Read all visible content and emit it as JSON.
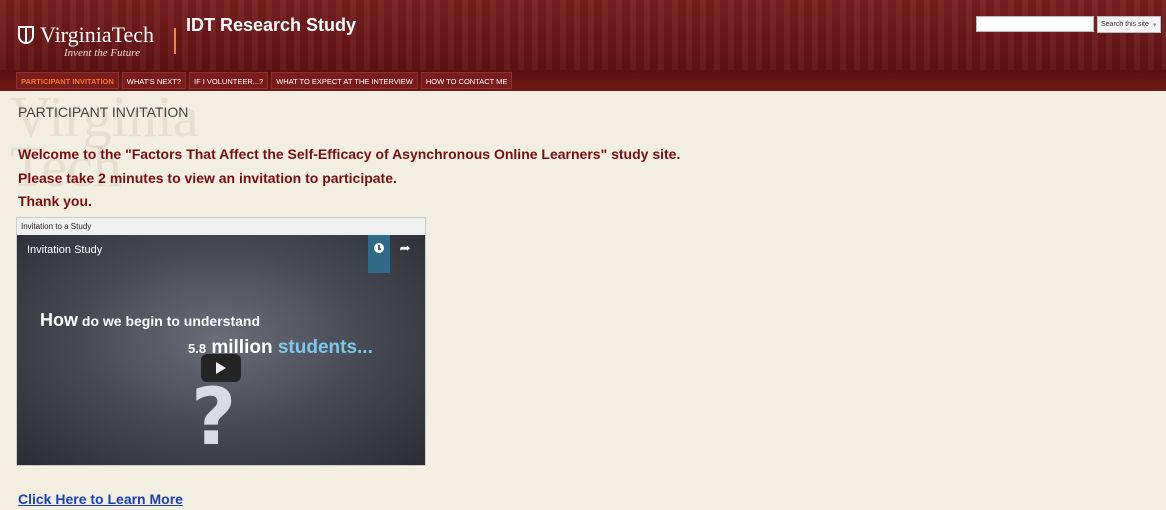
{
  "header": {
    "logo_text": "VirginiaTech",
    "logo_tagline": "Invent the Future",
    "site_title": "IDT Research Study",
    "search_placeholder": "",
    "search_button_label": "Search this site",
    "search_dropdown_glyph": "▾"
  },
  "nav": {
    "items": [
      {
        "label": "PARTICIPANT INVITATION"
      },
      {
        "label": "WHAT'S NEXT?"
      },
      {
        "label": "IF I VOLUNTEER...?"
      },
      {
        "label": "WHAT TO EXPECT AT THE INTERVIEW"
      },
      {
        "label": "HOW TO CONTACT ME"
      }
    ]
  },
  "main": {
    "watermark": "Virginia Tech",
    "page_heading": "PARTICIPANT INVITATION",
    "welcome_line1": "Welcome to the \"Factors That Affect the Self-Efficacy of Asynchronous Online Learners\" study site.",
    "welcome_line2": "Please take 2 minutes to view an invitation to participate.",
    "welcome_line3": "Thank you.",
    "video": {
      "box_label": "Invitation to a Study",
      "title": "Invitation Study",
      "line1_big": "How",
      "line1_rest": " do we begin to understand",
      "line2_num": "5.8",
      "line2_mid": " million",
      "line2_accent": " students...",
      "question_glyph": "?"
    },
    "learn_more_link": "Click Here to Learn More"
  },
  "colors": {
    "header_bg": "#6a1717",
    "nav_active_text": "#f07a2a",
    "welcome_text": "#7a0e0e",
    "link": "#1a3fb6",
    "page_bg": "#f2efe2"
  }
}
